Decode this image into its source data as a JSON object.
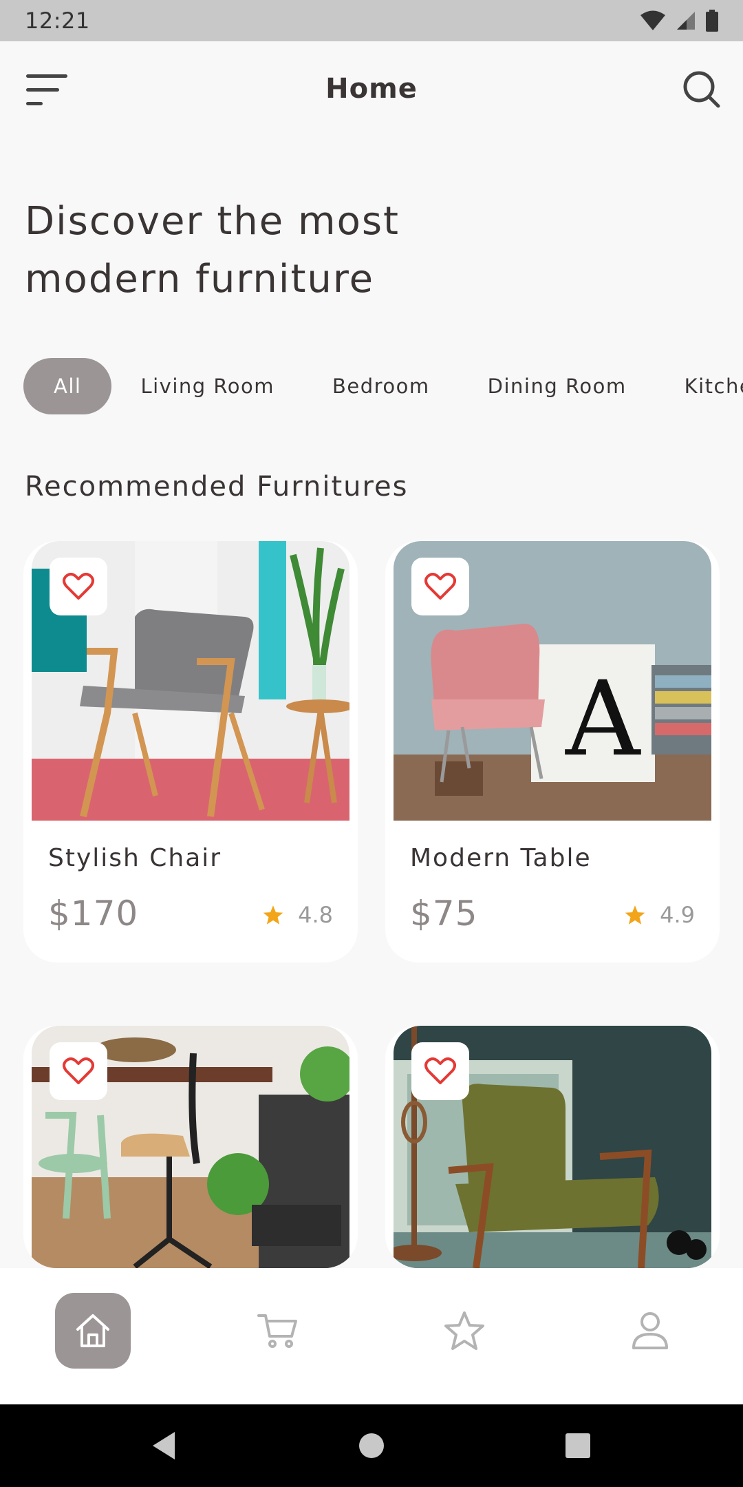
{
  "status_bar": {
    "time": "12:21"
  },
  "header": {
    "title": "Home",
    "menu_icon": "menu-icon",
    "search_icon": "search-icon"
  },
  "hero": {
    "line1": "Discover the most",
    "line2": "modern furniture"
  },
  "categories": [
    {
      "label": "All",
      "selected": true
    },
    {
      "label": "Living Room",
      "selected": false
    },
    {
      "label": "Bedroom",
      "selected": false
    },
    {
      "label": "Dining Room",
      "selected": false
    },
    {
      "label": "Kitchen",
      "selected": false
    }
  ],
  "section": {
    "title": "Recommended Furnitures"
  },
  "products": [
    {
      "name": "Stylish Chair",
      "price": "$170",
      "rating": "4.8"
    },
    {
      "name": "Modern Table",
      "price": "$75",
      "rating": "4.9"
    },
    {
      "name": "",
      "price": "",
      "rating": ""
    },
    {
      "name": "",
      "price": "",
      "rating": ""
    }
  ],
  "bottom_nav": [
    {
      "icon": "home-icon",
      "active": true
    },
    {
      "icon": "cart-icon",
      "active": false
    },
    {
      "icon": "star-icon",
      "active": false
    },
    {
      "icon": "profile-icon",
      "active": false
    }
  ],
  "colors": {
    "accent": "#9b9595",
    "heart": "#e53935",
    "star": "#f2a51a",
    "background": "#f8f8f8"
  }
}
